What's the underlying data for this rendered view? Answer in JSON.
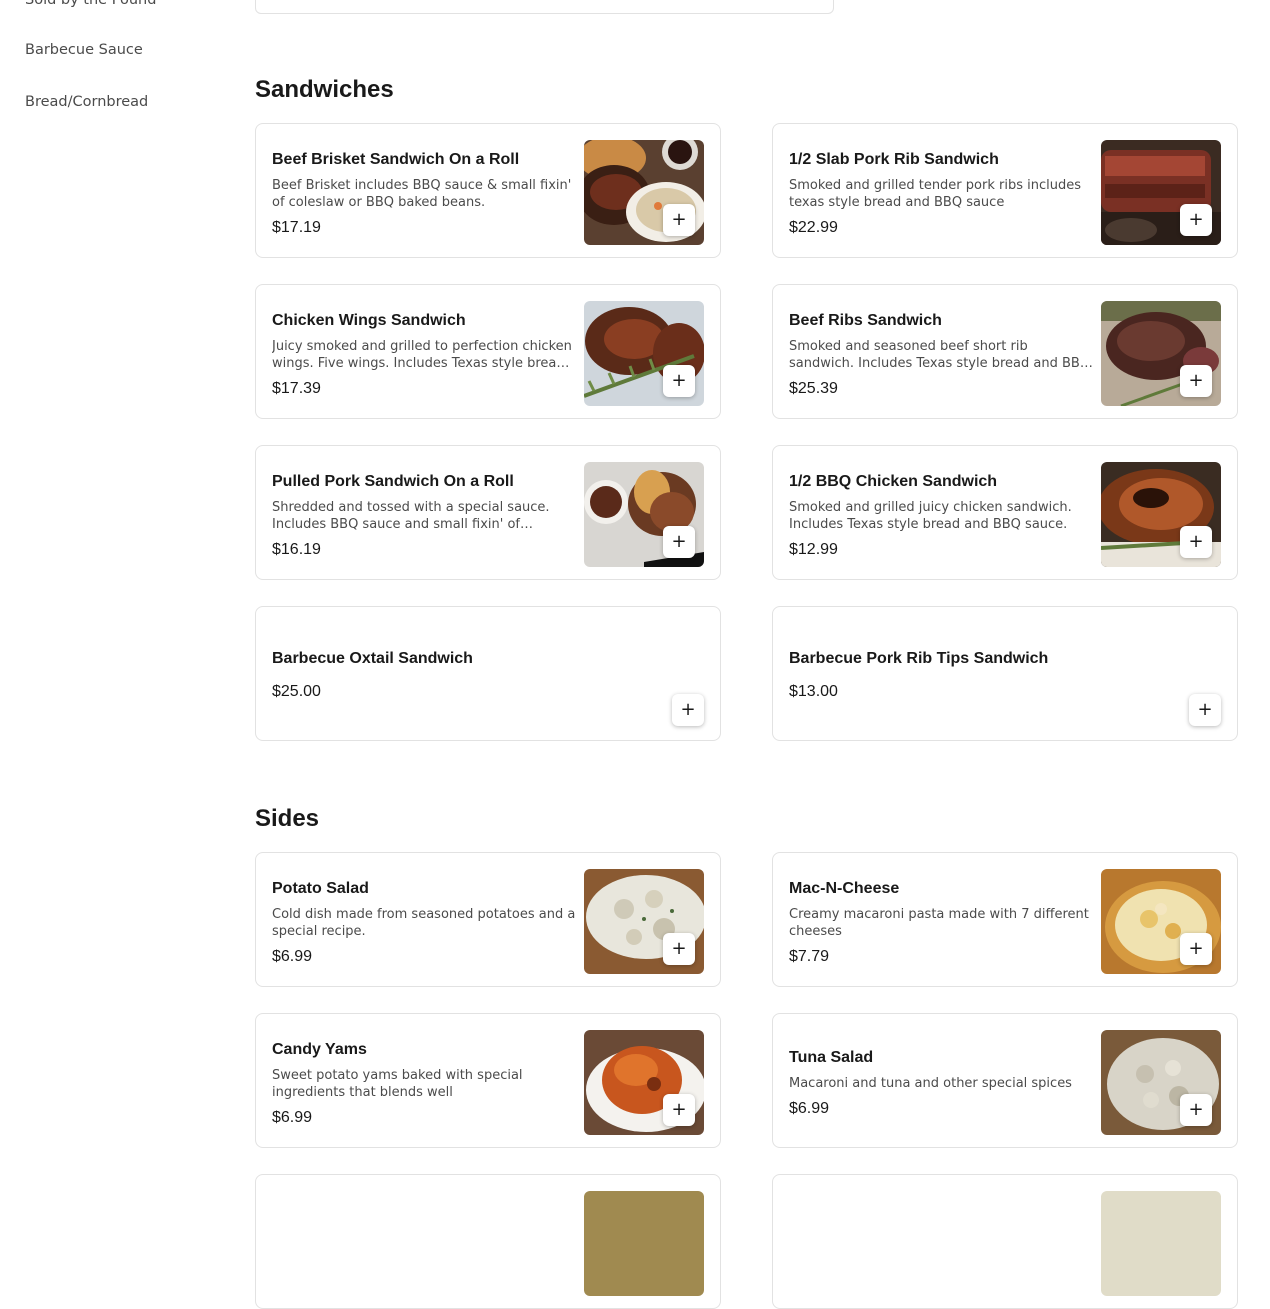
{
  "sidebar": {
    "items": [
      {
        "label": "Sold by the Pound"
      },
      {
        "label": "Barbecue Sauce"
      },
      {
        "label": "Bread/Cornbread"
      }
    ]
  },
  "sections": [
    {
      "title": "Sandwiches",
      "items": [
        {
          "name": "Beef Brisket Sandwich On a Roll",
          "description": "Beef Brisket includes BBQ sauce & small fixin' of coleslaw or BBQ baked beans.",
          "price": "$17.19",
          "image": "brisket-sandwich"
        },
        {
          "name": "1/2 Slab Pork Rib Sandwich",
          "description": "Smoked and grilled tender pork ribs includes texas style bread and BBQ sauce",
          "price": "$22.99",
          "image": "pork-ribs"
        },
        {
          "name": "Chicken Wings Sandwich",
          "description": "Juicy smoked and grilled to perfection chicken wings. Five wings. Includes Texas style bread and BBQ sauce.",
          "price": "$17.39",
          "image": "chicken-wings"
        },
        {
          "name": "Beef Ribs Sandwich",
          "description": "Smoked and seasoned beef short rib sandwich. Includes Texas style bread and BBQ sauce.",
          "price": "$25.39",
          "image": "beef-ribs"
        },
        {
          "name": "Pulled Pork Sandwich On a Roll",
          "description": "Shredded and tossed with a special sauce. Includes BBQ sauce and small fixin' of coleslaw or BBQ baked beans.",
          "price": "$16.19",
          "image": "pulled-pork"
        },
        {
          "name": "1/2 BBQ Chicken Sandwich",
          "description": "Smoked and grilled juicy chicken sandwich. Includes Texas style bread and BBQ sauce.",
          "price": "$12.99",
          "image": "bbq-chicken"
        },
        {
          "name": "Barbecue Oxtail Sandwich",
          "description": "",
          "price": "$25.00",
          "image": ""
        },
        {
          "name": "Barbecue Pork Rib Tips Sandwich",
          "description": "",
          "price": "$13.00",
          "image": ""
        }
      ]
    },
    {
      "title": "Sides",
      "items": [
        {
          "name": "Potato Salad",
          "description": "Cold dish made from seasoned potatoes and a special recipe.",
          "price": "$6.99",
          "image": "potato-salad"
        },
        {
          "name": "Mac-N-Cheese",
          "description": "Creamy macaroni pasta made with 7 different cheeses",
          "price": "$7.79",
          "image": "mac-n-cheese"
        },
        {
          "name": "Candy Yams",
          "description": "Sweet potato yams baked with special ingredients that blends well",
          "price": "$6.99",
          "image": "candy-yams"
        },
        {
          "name": "Tuna Salad",
          "description": "Macaroni and tuna and other special spices",
          "price": "$6.99",
          "image": "tuna-salad"
        }
      ]
    }
  ],
  "add_button_icon": "plus-icon",
  "add_button_glyph": "+"
}
